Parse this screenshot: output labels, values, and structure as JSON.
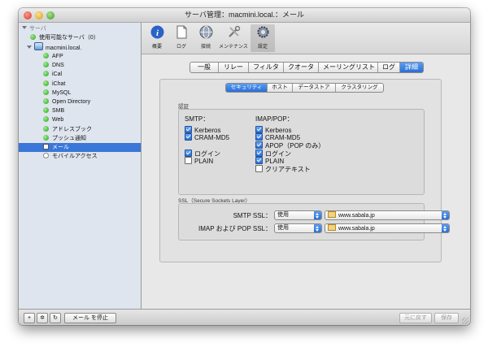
{
  "window": {
    "title": "サーバ管理：macmini.local.：メール"
  },
  "sidebar": {
    "header": "サーバ",
    "available": "使用可能なサーバ（0）",
    "server": "macmini.local.",
    "services": [
      {
        "label": "AFP",
        "status": "on"
      },
      {
        "label": "DNS",
        "status": "on"
      },
      {
        "label": "iCal",
        "status": "on"
      },
      {
        "label": "iChat",
        "status": "on"
      },
      {
        "label": "MySQL",
        "status": "on"
      },
      {
        "label": "Open Directory",
        "status": "on"
      },
      {
        "label": "SMB",
        "status": "on"
      },
      {
        "label": "Web",
        "status": "on"
      },
      {
        "label": "アドレスブック",
        "status": "on"
      },
      {
        "label": "プッシュ通知",
        "status": "on"
      },
      {
        "label": "メール",
        "status": "on"
      },
      {
        "label": "モバイルアクセス",
        "status": "off"
      }
    ],
    "selected": "メール"
  },
  "toolbar": {
    "items": [
      "概要",
      "ログ",
      "接続",
      "メンテナンス",
      "設定"
    ],
    "active": "設定"
  },
  "tabs": [
    "一般",
    "リレー",
    "フィルタ",
    "クオータ",
    "メーリングリスト",
    "ログ",
    "詳細"
  ],
  "active_tab": "詳細",
  "subtabs": [
    "セキュリティ",
    "ホスト",
    "データストア",
    "クラスタリング"
  ],
  "active_subtab": "セキュリティ",
  "auth": {
    "group_label": "認証",
    "smtp_title": "SMTP：",
    "imap_title": "IMAP/POP：",
    "smtp": [
      {
        "label": "Kerberos",
        "checked": true
      },
      {
        "label": "CRAM-MD5",
        "checked": true
      },
      {
        "label": "ログイン",
        "checked": true
      },
      {
        "label": "PLAIN",
        "checked": false
      }
    ],
    "imap": [
      {
        "label": "Kerberos",
        "checked": true
      },
      {
        "label": "CRAM-MD5",
        "checked": true
      },
      {
        "label": "APOP（POP のみ）",
        "checked": true
      },
      {
        "label": "ログイン",
        "checked": true
      },
      {
        "label": "PLAIN",
        "checked": true
      },
      {
        "label": "クリアテキスト",
        "checked": false
      }
    ]
  },
  "ssl": {
    "group_label": "SSL（Secure Sockets Layer）",
    "smtp_label": "SMTP SSL：",
    "smtp_mode": "使用",
    "smtp_cert": "www.sabala.jp",
    "imap_label": "IMAP および POP SSL：",
    "imap_mode": "使用",
    "imap_cert": "www.sabala.jp"
  },
  "bottom": {
    "add": "+",
    "gear": "✲",
    "refresh": "↻",
    "stop": "メール を停止",
    "revert": "元に戻す",
    "save": "保存"
  }
}
